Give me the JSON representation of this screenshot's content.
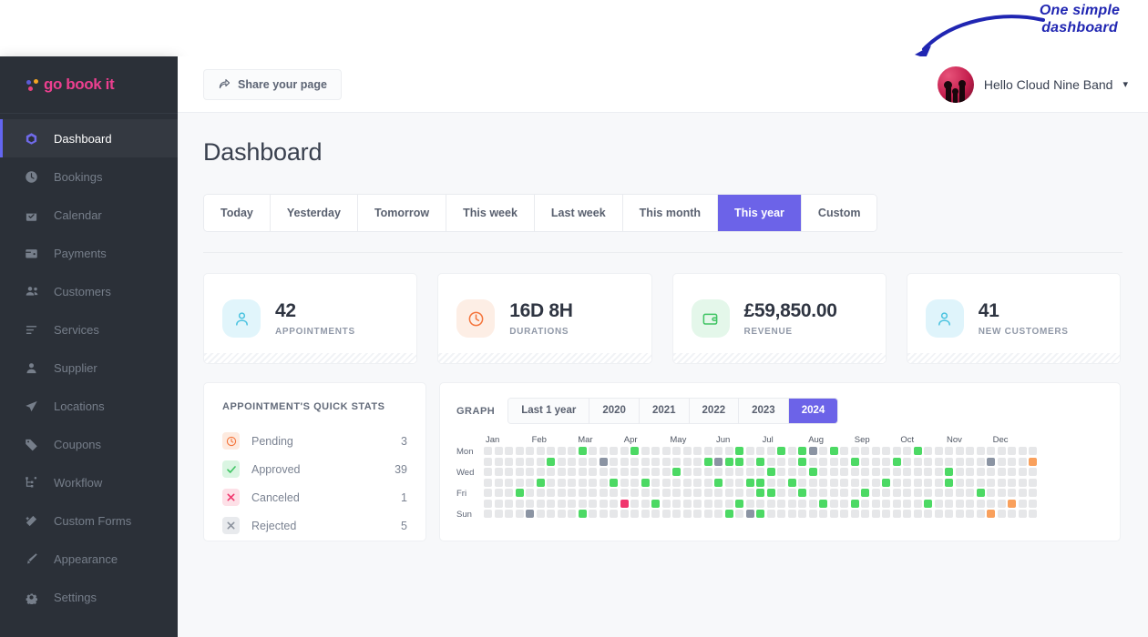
{
  "annotation": {
    "line1": "One simple",
    "line2": "dashboard",
    "color": "#2026b2"
  },
  "brand": {
    "name": "go book it",
    "dot_colors": [
      "#5b5bd6",
      "#f5a623",
      "#e8417e"
    ],
    "text_color": "#ec3f8f"
  },
  "sidebar": {
    "items": [
      {
        "label": "Dashboard",
        "icon": "cube-icon",
        "active": true
      },
      {
        "label": "Bookings",
        "icon": "clock-icon",
        "active": false
      },
      {
        "label": "Calendar",
        "icon": "calendar-icon",
        "active": false
      },
      {
        "label": "Payments",
        "icon": "wallet-icon",
        "active": false
      },
      {
        "label": "Customers",
        "icon": "users-icon",
        "active": false
      },
      {
        "label": "Services",
        "icon": "list-icon",
        "active": false
      },
      {
        "label": "Supplier",
        "icon": "user-icon",
        "active": false
      },
      {
        "label": "Locations",
        "icon": "send-icon",
        "active": false
      },
      {
        "label": "Coupons",
        "icon": "tag-icon",
        "active": false
      },
      {
        "label": "Workflow",
        "icon": "workflow-icon",
        "active": false
      },
      {
        "label": "Custom Forms",
        "icon": "magic-wand-icon",
        "active": false
      },
      {
        "label": "Appearance",
        "icon": "brush-icon",
        "active": false
      },
      {
        "label": "Settings",
        "icon": "gear-icon",
        "active": false
      }
    ]
  },
  "topbar": {
    "share_label": "Share your page",
    "share_icon": "share-arrow-icon",
    "user_name": "Hello Cloud Nine Band",
    "caret_icon": "chevron-down-icon",
    "avatar_icon": "band-avatar"
  },
  "page": {
    "title": "Dashboard"
  },
  "range_tabs": {
    "items": [
      "Today",
      "Yesterday",
      "Tomorrow",
      "This week",
      "Last week",
      "This month",
      "This year",
      "Custom"
    ],
    "active": "This year",
    "active_color": "#6c63e8"
  },
  "stats": [
    {
      "value": "42",
      "label": "APPOINTMENTS",
      "icon": "person-icon",
      "icon_bg": "#e1f5fb",
      "icon_color": "#4cc3e0"
    },
    {
      "value": "16D 8H",
      "label": "DURATIONS",
      "icon": "clock-icon",
      "icon_bg": "#fdeee5",
      "icon_color": "#f4743b"
    },
    {
      "value": "£59,850.00",
      "label": "REVENUE",
      "icon": "wallet-icon",
      "icon_bg": "#e4f7ea",
      "icon_color": "#3fc463"
    },
    {
      "value": "41",
      "label": "NEW CUSTOMERS",
      "icon": "person-icon",
      "icon_bg": "#dff4fb",
      "icon_color": "#4cc3e0"
    }
  ],
  "quick_stats": {
    "title": "APPOINTMENT'S QUICK STATS",
    "rows": [
      {
        "label": "Pending",
        "count": "3",
        "icon": "clock-icon",
        "icon_bg": "#fdeadf",
        "icon_color": "#f4743b"
      },
      {
        "label": "Approved",
        "count": "39",
        "icon": "check-icon",
        "icon_bg": "#daf5e2",
        "icon_color": "#3fc463"
      },
      {
        "label": "Canceled",
        "count": "1",
        "icon": "x-icon",
        "icon_bg": "#fde0e7",
        "icon_color": "#f0366d"
      },
      {
        "label": "Rejected",
        "count": "5",
        "icon": "x-icon",
        "icon_bg": "#e8eaed",
        "icon_color": "#8b929d"
      }
    ]
  },
  "graph": {
    "label": "GRAPH",
    "year_tabs": [
      "Last 1 year",
      "2020",
      "2021",
      "2022",
      "2023",
      "2024"
    ],
    "active_year": "2024"
  },
  "chart_data": {
    "type": "heatmap",
    "title": "GRAPH",
    "year": "2024",
    "xlabel": "",
    "ylabel": "",
    "month_labels": [
      "Jan",
      "Feb",
      "Mar",
      "Apr",
      "May",
      "Jun",
      "Jul",
      "Aug",
      "Sep",
      "Oct",
      "Nov",
      "Dec"
    ],
    "month_positions_weeks": [
      0,
      4.4,
      8.8,
      13.2,
      17.6,
      22.0,
      26.4,
      30.8,
      35.2,
      39.6,
      44.0,
      48.4
    ],
    "day_labels": [
      "Mon",
      "",
      "Wed",
      "",
      "Fri",
      "",
      "Sun"
    ],
    "rows": 7,
    "weeks": 53,
    "legend": {
      "empty": "#e6e7e9",
      "green": "#4cd964",
      "grey": "#8b94a3",
      "pink": "#f0366d",
      "orange": "#f9a05c"
    },
    "cells": [
      {
        "row": 0,
        "col": 9,
        "color": "green"
      },
      {
        "row": 0,
        "col": 14,
        "color": "green"
      },
      {
        "row": 0,
        "col": 24,
        "color": "green"
      },
      {
        "row": 0,
        "col": 28,
        "color": "green"
      },
      {
        "row": 0,
        "col": 30,
        "color": "green"
      },
      {
        "row": 0,
        "col": 31,
        "color": "grey"
      },
      {
        "row": 0,
        "col": 33,
        "color": "green"
      },
      {
        "row": 0,
        "col": 41,
        "color": "green"
      },
      {
        "row": 1,
        "col": 6,
        "color": "green"
      },
      {
        "row": 1,
        "col": 11,
        "color": "grey"
      },
      {
        "row": 1,
        "col": 21,
        "color": "green"
      },
      {
        "row": 1,
        "col": 22,
        "color": "grey"
      },
      {
        "row": 1,
        "col": 23,
        "color": "green"
      },
      {
        "row": 1,
        "col": 24,
        "color": "green"
      },
      {
        "row": 1,
        "col": 26,
        "color": "green"
      },
      {
        "row": 1,
        "col": 30,
        "color": "green"
      },
      {
        "row": 1,
        "col": 35,
        "color": "green"
      },
      {
        "row": 1,
        "col": 39,
        "color": "green"
      },
      {
        "row": 1,
        "col": 48,
        "color": "grey"
      },
      {
        "row": 1,
        "col": 52,
        "color": "orange"
      },
      {
        "row": 2,
        "col": 18,
        "color": "green"
      },
      {
        "row": 2,
        "col": 27,
        "color": "green"
      },
      {
        "row": 2,
        "col": 31,
        "color": "green"
      },
      {
        "row": 2,
        "col": 44,
        "color": "green"
      },
      {
        "row": 3,
        "col": 5,
        "color": "green"
      },
      {
        "row": 3,
        "col": 12,
        "color": "green"
      },
      {
        "row": 3,
        "col": 15,
        "color": "green"
      },
      {
        "row": 3,
        "col": 22,
        "color": "green"
      },
      {
        "row": 3,
        "col": 25,
        "color": "green"
      },
      {
        "row": 3,
        "col": 26,
        "color": "green"
      },
      {
        "row": 3,
        "col": 29,
        "color": "green"
      },
      {
        "row": 3,
        "col": 38,
        "color": "green"
      },
      {
        "row": 3,
        "col": 44,
        "color": "green"
      },
      {
        "row": 4,
        "col": 3,
        "color": "green"
      },
      {
        "row": 4,
        "col": 26,
        "color": "green"
      },
      {
        "row": 4,
        "col": 27,
        "color": "green"
      },
      {
        "row": 4,
        "col": 30,
        "color": "green"
      },
      {
        "row": 4,
        "col": 36,
        "color": "green"
      },
      {
        "row": 4,
        "col": 47,
        "color": "green"
      },
      {
        "row": 5,
        "col": 13,
        "color": "pink"
      },
      {
        "row": 5,
        "col": 16,
        "color": "green"
      },
      {
        "row": 5,
        "col": 24,
        "color": "green"
      },
      {
        "row": 5,
        "col": 32,
        "color": "green"
      },
      {
        "row": 5,
        "col": 35,
        "color": "green"
      },
      {
        "row": 5,
        "col": 42,
        "color": "green"
      },
      {
        "row": 5,
        "col": 50,
        "color": "orange"
      },
      {
        "row": 6,
        "col": 4,
        "color": "grey"
      },
      {
        "row": 6,
        "col": 9,
        "color": "green"
      },
      {
        "row": 6,
        "col": 23,
        "color": "green"
      },
      {
        "row": 6,
        "col": 25,
        "color": "grey"
      },
      {
        "row": 6,
        "col": 26,
        "color": "green"
      },
      {
        "row": 6,
        "col": 48,
        "color": "orange"
      }
    ]
  }
}
